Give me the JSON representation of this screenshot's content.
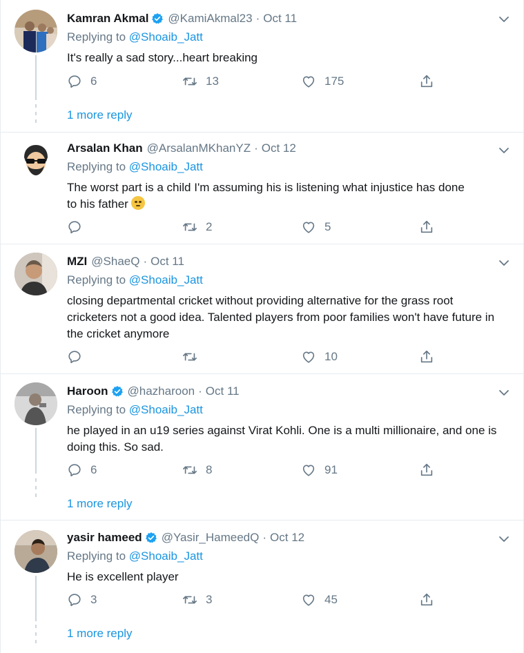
{
  "colors": {
    "accent": "#1b95e0",
    "muted": "#657786",
    "text": "#14171a",
    "verified": "#1da1f2",
    "divider": "#e6ecf0"
  },
  "tweets": [
    {
      "name": "Kamran Akmal",
      "verified": true,
      "handle": "@KamiAkmal23",
      "sep": "·",
      "time": "Oct 11",
      "replying_prefix": "Replying to",
      "replying_to": "@Shoaib_Jatt",
      "text": "It's really a sad story...heart breaking",
      "replies": "6",
      "retweets": "13",
      "likes": "175",
      "more_reply": "1 more reply"
    },
    {
      "name": "Arsalan Khan",
      "verified": false,
      "handle": "@ArsalanMKhanYZ",
      "sep": "·",
      "time": "Oct 12",
      "replying_prefix": "Replying to",
      "replying_to": "@Shoaib_Jatt",
      "text_line1": "The worst part is a child I'm assuming his is listening what injustice has done",
      "text_line2": "to his father",
      "replies": "",
      "retweets": "2",
      "likes": "5"
    },
    {
      "name": "MZI",
      "verified": false,
      "handle": "@ShaeQ",
      "sep": "·",
      "time": "Oct 11",
      "replying_prefix": "Replying to",
      "replying_to": "@Shoaib_Jatt",
      "text": "closing departmental cricket without providing alternative for the grass root cricketers not a good idea. Talented players from poor families won't have future in the cricket anymore",
      "replies": "",
      "retweets": "",
      "likes": "10"
    },
    {
      "name": "Haroon",
      "verified": true,
      "handle": "@hazharoon",
      "sep": "·",
      "time": "Oct 11",
      "replying_prefix": "Replying to",
      "replying_to": "@Shoaib_Jatt",
      "text": "he played in an u19 series against Virat Kohli. One is a multi millionaire, and one is doing this. So sad.",
      "replies": "6",
      "retweets": "8",
      "likes": "91",
      "more_reply": "1 more reply"
    },
    {
      "name": "yasir hameed",
      "verified": true,
      "handle": "@Yasir_HameedQ",
      "sep": "·",
      "time": "Oct 12",
      "replying_prefix": "Replying to",
      "replying_to": "@Shoaib_Jatt",
      "text": "He is excellent player",
      "replies": "3",
      "retweets": "3",
      "likes": "45",
      "more_reply": "1 more reply"
    }
  ]
}
